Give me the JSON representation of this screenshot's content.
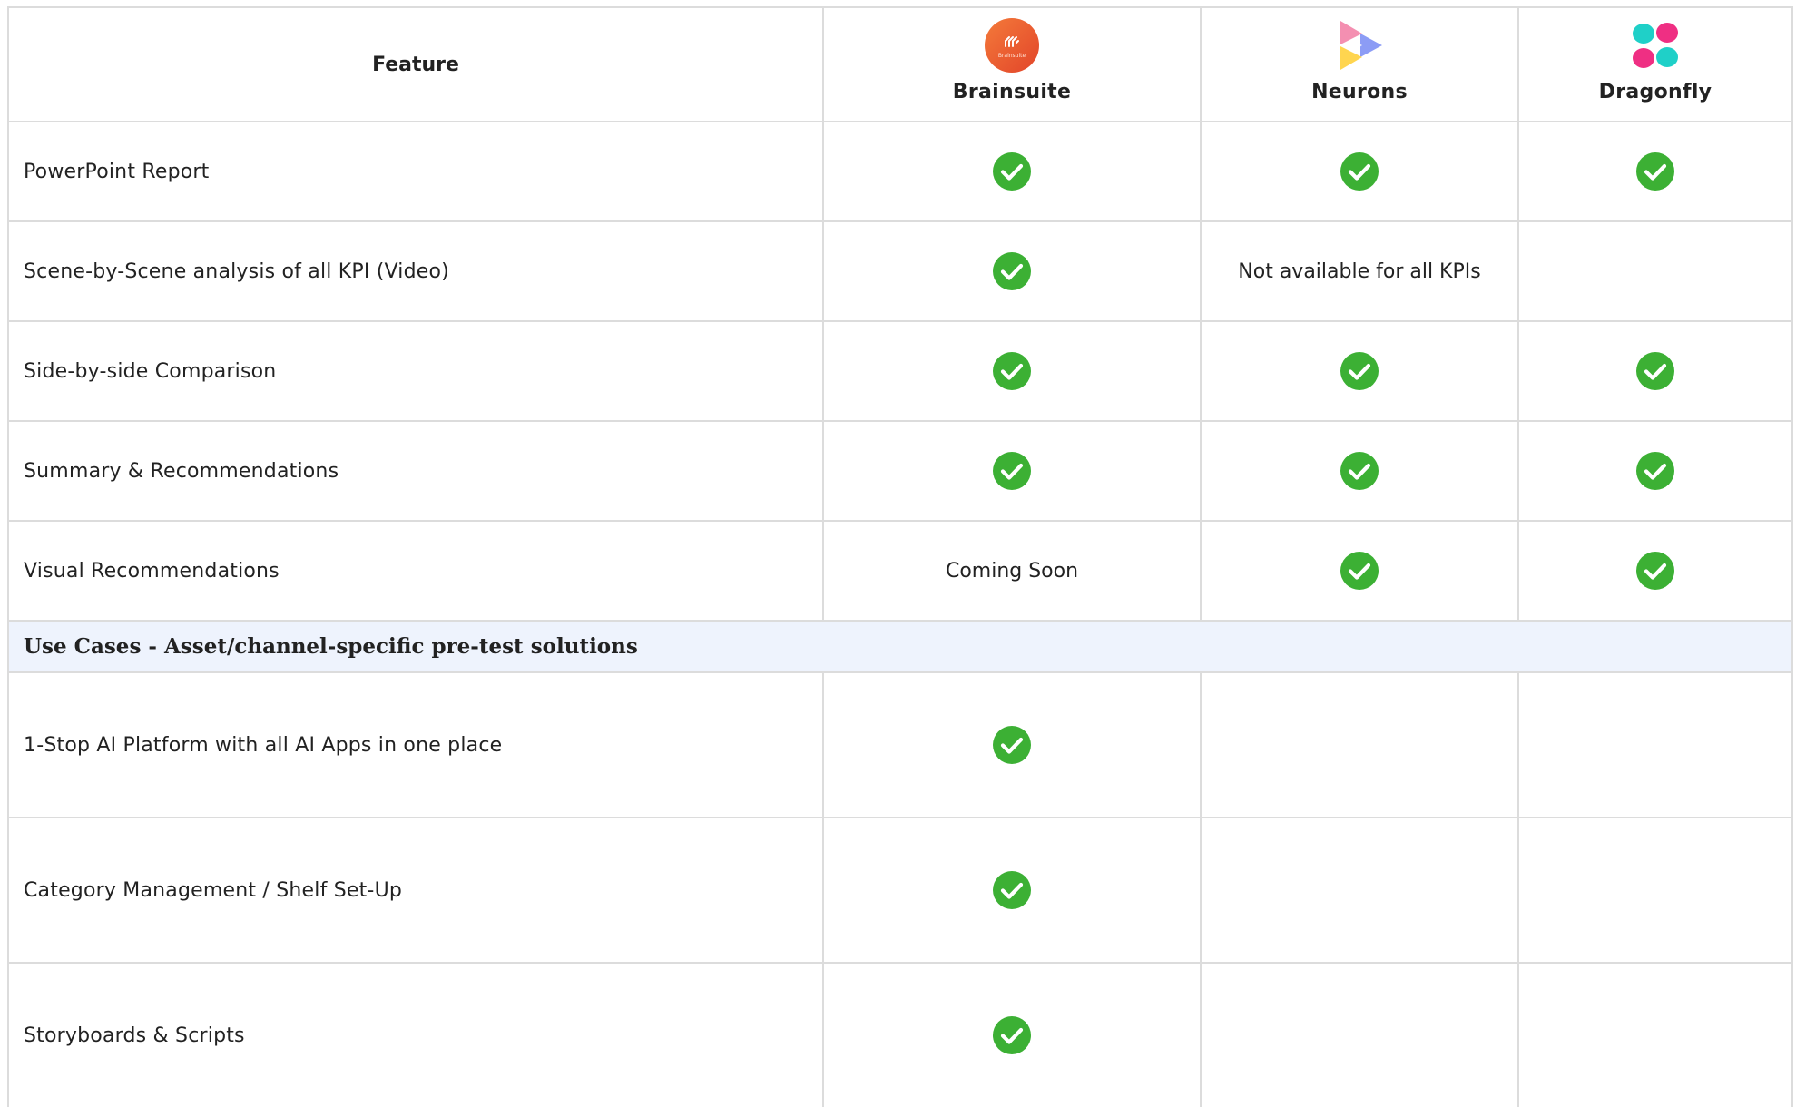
{
  "header": {
    "feature_label": "Feature",
    "vendors": [
      {
        "name": "Brainsuite",
        "icon": "brainsuite-logo-icon"
      },
      {
        "name": "Neurons",
        "icon": "neurons-logo-icon"
      },
      {
        "name": "Dragonfly",
        "icon": "dragonfly-logo-icon"
      }
    ]
  },
  "logo_text": "Brainsuite",
  "rows": [
    {
      "feature": "PowerPoint Report",
      "brainsuite": "check",
      "neurons": "check",
      "dragonfly": "check"
    },
    {
      "feature": "Scene-by-Scene analysis of all KPI (Video)",
      "brainsuite": "check",
      "neurons": "Not available for all KPIs",
      "dragonfly": ""
    },
    {
      "feature": "Side-by-side Comparison",
      "brainsuite": "check",
      "neurons": "check",
      "dragonfly": "check"
    },
    {
      "feature": "Summary & Recommendations",
      "brainsuite": "check",
      "neurons": "check",
      "dragonfly": "check"
    },
    {
      "feature": "Visual Recommendations",
      "brainsuite": "Coming Soon",
      "neurons": "check",
      "dragonfly": "check"
    }
  ],
  "section": {
    "title": "Use Cases - Asset/channel-specific pre-test solutions"
  },
  "use_cases": [
    {
      "feature": "1-Stop AI Platform with all AI Apps in one place",
      "brainsuite": "check",
      "neurons": "",
      "dragonfly": ""
    },
    {
      "feature": "Category Management / Shelf Set-Up",
      "brainsuite": "check",
      "neurons": "",
      "dragonfly": ""
    },
    {
      "feature": "Storyboards & Scripts",
      "brainsuite": "check",
      "neurons": "",
      "dragonfly": ""
    }
  ],
  "colors": {
    "check_green": "#3cb034",
    "section_bg": "#eef3fd",
    "grid": "#dcdcdc",
    "brainsuite_orange": "#ec5a2c",
    "neurons_pink": "#f48fb1",
    "neurons_blue": "#8c9cf5",
    "neurons_yellow": "#ffd54f",
    "dragonfly_teal": "#1fd0c8",
    "dragonfly_pink": "#ef2f83"
  }
}
